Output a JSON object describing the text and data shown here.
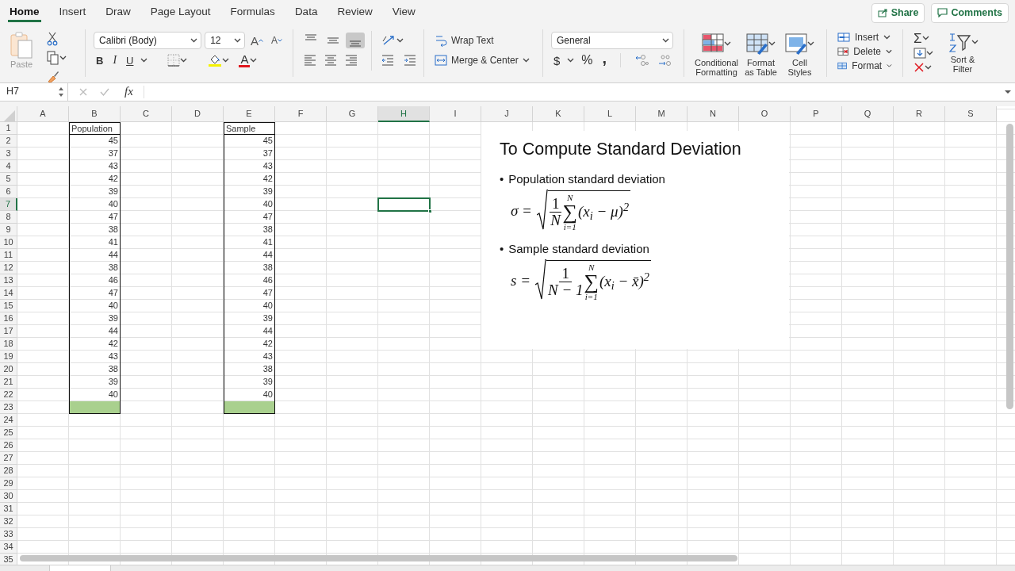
{
  "tabs": [
    {
      "label": "Home",
      "selected": true
    },
    {
      "label": "Insert",
      "selected": false
    },
    {
      "label": "Draw",
      "selected": false
    },
    {
      "label": "Page Layout",
      "selected": false
    },
    {
      "label": "Formulas",
      "selected": false
    },
    {
      "label": "Data",
      "selected": false
    },
    {
      "label": "Review",
      "selected": false
    },
    {
      "label": "View",
      "selected": false
    }
  ],
  "share_button": "Share",
  "comments_button": "Comments",
  "ribbon": {
    "paste_label": "Paste",
    "font_name": "Calibri (Body)",
    "font_size": "12",
    "grow_font": "A",
    "shrink_font": "A",
    "bold": "B",
    "italic": "I",
    "underline": "U",
    "font_color": "A",
    "alignment": [
      {
        "kind": "top",
        "selected": false
      },
      {
        "kind": "middle",
        "selected": false
      },
      {
        "kind": "bottom",
        "selected": true
      },
      {
        "kind": "left",
        "selected": false
      },
      {
        "kind": "center",
        "selected": false
      },
      {
        "kind": "right",
        "selected": false
      }
    ],
    "wrap_text": "Wrap Text",
    "merge_center": "Merge & Center",
    "number_format": "General",
    "currency": "$",
    "percent": "%",
    "comma_style": ",",
    "style_buttons": [
      {
        "kind": "conditional",
        "label": "Conditional Formatting"
      },
      {
        "kind": "table",
        "label": "Format as Table"
      },
      {
        "kind": "styles",
        "label": "Cell Styles"
      }
    ],
    "cell_buttons": [
      {
        "kind": "insert",
        "label": "Insert"
      },
      {
        "kind": "delete",
        "label": "Delete"
      },
      {
        "kind": "format",
        "label": "Format"
      }
    ],
    "autosum": "Σ",
    "sort_filter": "Sort & Filter"
  },
  "formula_bar": {
    "name_box": "H7",
    "function_label": "fx"
  },
  "sheet": {
    "columns": [
      {
        "label": "A",
        "selected": false
      },
      {
        "label": "B",
        "selected": false
      },
      {
        "label": "C",
        "selected": false
      },
      {
        "label": "D",
        "selected": false
      },
      {
        "label": "E",
        "selected": false
      },
      {
        "label": "F",
        "selected": false
      },
      {
        "label": "G",
        "selected": false
      },
      {
        "label": "H",
        "selected": true
      },
      {
        "label": "I",
        "selected": false
      },
      {
        "label": "J",
        "selected": false
      },
      {
        "label": "K",
        "selected": false
      },
      {
        "label": "L",
        "selected": false
      },
      {
        "label": "M",
        "selected": false
      },
      {
        "label": "N",
        "selected": false
      },
      {
        "label": "O",
        "selected": false
      },
      {
        "label": "P",
        "selected": false
      },
      {
        "label": "Q",
        "selected": false
      },
      {
        "label": "R",
        "selected": false
      },
      {
        "label": "S",
        "selected": false
      }
    ],
    "rows": [
      {
        "label": "1",
        "selected": false
      },
      {
        "label": "2",
        "selected": false
      },
      {
        "label": "3",
        "selected": false
      },
      {
        "label": "4",
        "selected": false
      },
      {
        "label": "5",
        "selected": false
      },
      {
        "label": "6",
        "selected": false
      },
      {
        "label": "7",
        "selected": true
      },
      {
        "label": "8",
        "selected": false
      },
      {
        "label": "9",
        "selected": false
      },
      {
        "label": "10",
        "selected": false
      },
      {
        "label": "11",
        "selected": false
      },
      {
        "label": "12",
        "selected": false
      },
      {
        "label": "13",
        "selected": false
      },
      {
        "label": "14",
        "selected": false
      },
      {
        "label": "15",
        "selected": false
      },
      {
        "label": "16",
        "selected": false
      },
      {
        "label": "17",
        "selected": false
      },
      {
        "label": "18",
        "selected": false
      },
      {
        "label": "19",
        "selected": false
      },
      {
        "label": "20",
        "selected": false
      },
      {
        "label": "21",
        "selected": false
      },
      {
        "label": "22",
        "selected": false
      },
      {
        "label": "23",
        "selected": false
      },
      {
        "label": "24",
        "selected": false
      },
      {
        "label": "25",
        "selected": false
      },
      {
        "label": "26",
        "selected": false
      },
      {
        "label": "27",
        "selected": false
      },
      {
        "label": "28",
        "selected": false
      },
      {
        "label": "29",
        "selected": false
      },
      {
        "label": "30",
        "selected": false
      },
      {
        "label": "31",
        "selected": false
      },
      {
        "label": "32",
        "selected": false
      },
      {
        "label": "33",
        "selected": false
      },
      {
        "label": "34",
        "selected": false
      },
      {
        "label": "35",
        "selected": false
      }
    ],
    "data_columns": [
      {
        "header": "Population",
        "values": [
          "45",
          "37",
          "43",
          "42",
          "39",
          "40",
          "47",
          "38",
          "41",
          "44",
          "38",
          "46",
          "47",
          "40",
          "39",
          "44",
          "42",
          "43",
          "38",
          "39",
          "40"
        ],
        "total_filled": true
      },
      {
        "header": "Sample",
        "values": [
          "45",
          "37",
          "43",
          "42",
          "39",
          "40",
          "47",
          "38",
          "41",
          "44",
          "38",
          "46",
          "47",
          "40",
          "39",
          "44",
          "42",
          "43",
          "38",
          "39",
          "40"
        ],
        "total_filled": true
      }
    ]
  },
  "formula_image": {
    "title": "To Compute Standard Deviation",
    "items": [
      {
        "bullet": "•",
        "label": "Population standard deviation",
        "formula": {
          "lhs": "σ =",
          "numerator": "1",
          "denominator": "N",
          "sum_upper": "N",
          "sum_sign": "∑",
          "sum_lower": "i=1",
          "term": "(x$_{i}$ − μ)$^{2}$"
        }
      },
      {
        "bullet": "•",
        "label": "Sample standard deviation",
        "formula": {
          "lhs": "s =",
          "numerator": "1",
          "denominator": "N − 1",
          "sum_upper": "N",
          "sum_sign": "∑",
          "sum_lower": "i=1",
          "term": "(x$_{i}$ − x̄)$^{2}$"
        }
      }
    ]
  }
}
